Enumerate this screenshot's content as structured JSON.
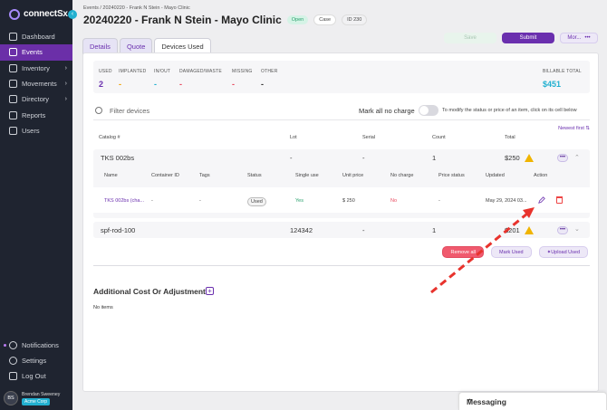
{
  "app": {
    "name": "connectSx",
    "sub": ""
  },
  "nav": [
    {
      "label": "Dashboard",
      "chev": false
    },
    {
      "label": "Events",
      "chev": false,
      "active": true
    },
    {
      "label": "Inventory",
      "chev": true
    },
    {
      "label": "Movements",
      "chev": true
    },
    {
      "label": "Directory",
      "chev": true
    },
    {
      "label": "Reports",
      "chev": false
    },
    {
      "label": "Users",
      "chev": false
    }
  ],
  "nav_bottom": {
    "notifications": "Notifications",
    "settings": "Settings",
    "logout": "Log Out"
  },
  "user": {
    "initials": "BS",
    "name": "Brendan Sweeney",
    "org": "Acme Corp"
  },
  "breadcrumb": "Events / 20240220 - Frank N Stein - Mayo Clinic",
  "title": "20240220 - Frank N Stein - Mayo Clinic",
  "badges": {
    "status": "Open",
    "type": "Case",
    "id": "ID 230"
  },
  "actions": {
    "save": "Save",
    "submit": "Submit",
    "more": "Mor..."
  },
  "tabs": [
    "Details",
    "Quote",
    "Devices Used"
  ],
  "stats": {
    "used": {
      "label": "USED",
      "value": "2"
    },
    "implanted": {
      "label": "IMPLANTED",
      "value": "-"
    },
    "inout": {
      "label": "IN/OUT",
      "value": "-"
    },
    "damaged": {
      "label": "DAMAGED/WASTE",
      "value": "-"
    },
    "missing": {
      "label": "MISSING",
      "value": "-"
    },
    "other": {
      "label": "OTHER",
      "value": "-"
    },
    "billable": {
      "label": "BILLABLE TOTAL",
      "value": "$451"
    }
  },
  "filter": {
    "placeholder": "Filter devices",
    "no_charge": "Mark all no charge",
    "hint": "To modify the status or price of an item, click on its cell below",
    "sort": "Newest first"
  },
  "columns": {
    "catalog": "Catalog #",
    "lot": "Lot",
    "serial": "Serial",
    "count": "Count",
    "total": "Total"
  },
  "groups": [
    {
      "catalog": "TKS 002bs",
      "lot": "-",
      "serial": "-",
      "count": "1",
      "total": "$250"
    },
    {
      "catalog": "spf-rod-100",
      "lot": "124342",
      "serial": "-",
      "count": "1",
      "total": "$201"
    }
  ],
  "sub_columns": {
    "name": "Name",
    "container": "Container ID",
    "tags": "Tags",
    "status": "Status",
    "single_use": "Single use",
    "unit_price": "Unit price",
    "no_charge": "No charge",
    "price_status": "Price status",
    "updated": "Updated",
    "action": "Action"
  },
  "sub_row": {
    "name": "TKS 002bs (cha...",
    "container": "-",
    "tags": "-",
    "status": "Used",
    "single_use": "Yes",
    "unit_price": "$ 250",
    "no_charge": "No",
    "price_status": "-",
    "updated": "May 29, 2024 03..."
  },
  "bottom_actions": {
    "remove": "Remove all",
    "mark": "Mark Used",
    "upload": "Upload Used"
  },
  "additional": {
    "title": "Additional Cost Or Adjustment",
    "empty": "No items"
  },
  "messaging": "Messaging",
  "colors": {
    "accent": "#6a2fae",
    "teal": "#22b0d0",
    "orange": "#f0a000",
    "red": "#e84a5f"
  }
}
